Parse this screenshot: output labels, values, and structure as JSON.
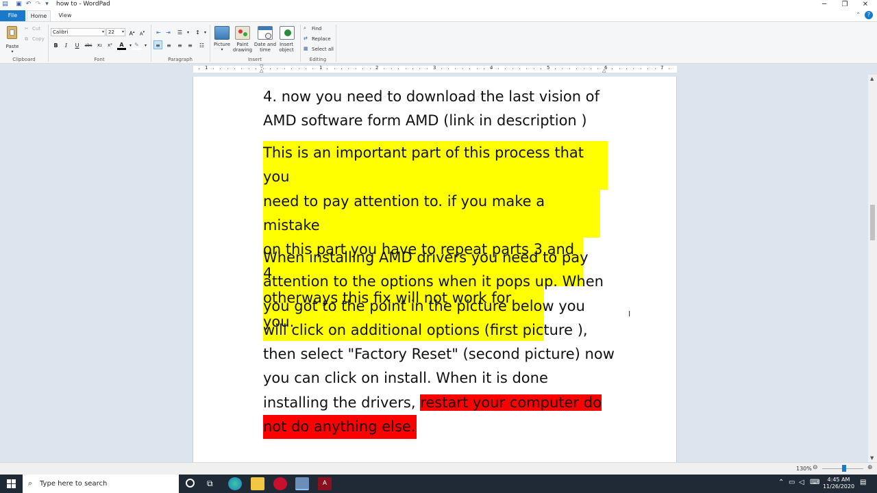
{
  "window": {
    "title": "how to - WordPad",
    "min_glyph": "─",
    "max_glyph": "❐",
    "close_glyph": "✕"
  },
  "tabs": {
    "file": "File",
    "home": "Home",
    "view": "View"
  },
  "ribbon": {
    "clipboard": {
      "label": "Clipboard",
      "paste": "Paste",
      "cut": "Cut",
      "copy": "Copy"
    },
    "font": {
      "label": "Font",
      "family": "Calibri",
      "size": "22",
      "bold": "B",
      "italic": "I",
      "underline": "U",
      "strike": "abc",
      "subscript": "x₂",
      "superscript": "x²"
    },
    "paragraph": {
      "label": "Paragraph"
    },
    "insert": {
      "label": "Insert",
      "picture": "Picture",
      "paint_l1": "Paint",
      "paint_l2": "drawing",
      "date_l1": "Date and",
      "date_l2": "time",
      "object_l1": "Insert",
      "object_l2": "object"
    },
    "editing": {
      "label": "Editing",
      "find": "Find",
      "replace": "Replace",
      "select_all": "Select all"
    }
  },
  "ruler": {
    "numbers": [
      "1",
      "1",
      "2",
      "3",
      "4",
      "5",
      "6",
      "7"
    ]
  },
  "document": {
    "p1_line1": "4. now you need to download the last vision of",
    "p1_line2": "AMD software form AMD (link in description )",
    "p2_line1": "This is an important part of this process that you",
    "p2_line2": "need to pay attention to. if you make a mistake",
    "p2_line3": "on this part you have to repeat parts 3 and 4",
    "p2_line4": "otherways this fix will not work for you.",
    "p3_line1": "When installing AMD drivers you need to pay",
    "p3_line2": "attention to the options when it pops up. When",
    "p3_line3": "you got to the point in the picture below you",
    "p3_line4": "will click on additional options (first picture ),",
    "p3_line5": "then select \"Factory Reset\" (second picture) now",
    "p3_line6": "you can click on install. When it is done",
    "p3_line7_plain": "installing the drivers, ",
    "p3_line7_red": "restart your computer do",
    "p3_line8_red": "not do anything else."
  },
  "status": {
    "zoom": "130%"
  },
  "taskbar": {
    "search_placeholder": "Type here to search",
    "time": "4:45 AM",
    "date": "11/26/2020"
  },
  "colors": {
    "highlight_yellow": "#ffff00",
    "highlight_red": "#ff0000",
    "accent": "#1979ca"
  }
}
